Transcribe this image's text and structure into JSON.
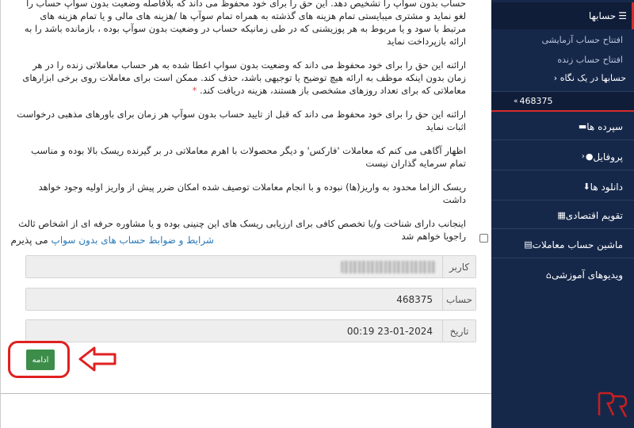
{
  "terms": {
    "para1": "حساب بدون سواپ را تشخیص دهد. این حق را برای خود محفوظ می داند که بلافاصله وضعیت بدون سواپ حساب را لغو نماید و مشتری میبایستی تمام هزینه های گذشته به همراه تمام سوآپ ها /هزینه های مالی و یا تمام هزینه های مرتبط با سود و یا مربوط به هر پوزیشنی که در طی زمانیکه حساب در وضعیت بدون سوآپ بوده ، بازمانده باشد را به ارائه بازپرداخت نماید",
    "para2": "ارائنه این حق را برای خود محفوظ می داند که وضعیت بدون سواپ اعطا شده به هر حساب معاملاتی زنده را در هر زمان بدون اینکه موظف به ارائه هیچ توضیح یا توجیهی باشد، حذف کند. ممکن است برای معاملات روی برخی ابزارهای معاملاتی که برای تعداد روزهای مشخصی باز هستند، هزینه دریافت کند.",
    "para2_marker": "*",
    "para3": "ارائنه این حق را برای خود محفوظ می داند که قبل از تایید حساب بدون سوآپ هر زمان برای باورهای مذهبی درخواست اثبات نماید",
    "para4": "اظهار آگاهی می کنم که معاملات 'فارکس' و دیگر محصولات با اهرم معاملاتی در بر گیرنده ریسک بالا بوده و مناسب تمام سرمایه گذاران نیست",
    "para5": "ریسک الزاما محدود به واریز(ها) نبوده و با انجام معاملات توصیف شده امکان ضرر پیش از واریز اولیه وجود خواهد داشت",
    "para6": "اینجانب دارای شناخت و/یا تخصص کافی برای ارزیابی ریسک های این چنینی بوده و یا مشاوره حرفه ای از اشخاص ثالث راجویا خواهم شد"
  },
  "agreement": {
    "link_text": "شرایط و ضوابط حساب های بدون سواپ",
    "suffix": " می پذیرم"
  },
  "form": {
    "user_label": "کاربر",
    "account_label": "حساب",
    "account_value": "468375",
    "date_label": "تاریخ",
    "date_value": "00:19 23-01-2024"
  },
  "continue_button": "ادامه",
  "sidebar": {
    "header": "حسابها",
    "submenu": {
      "demo": "افتتاح حساب آزمایشی",
      "live": "افتتاح حساب زنده",
      "overview": "حسابها در یک نگاه",
      "account": "468375"
    },
    "items": [
      {
        "label": "سپرده ها",
        "icon": "wallet-icon"
      },
      {
        "label": "پروفایل",
        "icon": "user-icon"
      },
      {
        "label": "دانلود ها",
        "icon": "download-icon"
      },
      {
        "label": "تقویم اقتصادی",
        "icon": "calendar-icon"
      },
      {
        "label": "ماشین حساب معاملات",
        "icon": "calculator-icon"
      },
      {
        "label": "ویدیوهای آموزشی",
        "icon": "institution-icon"
      }
    ]
  },
  "colors": {
    "sidebar_bg": "#16284a",
    "accent_red": "#d62b2b",
    "button_green": "#3c8d4a",
    "link_blue": "#2a7ab8"
  }
}
